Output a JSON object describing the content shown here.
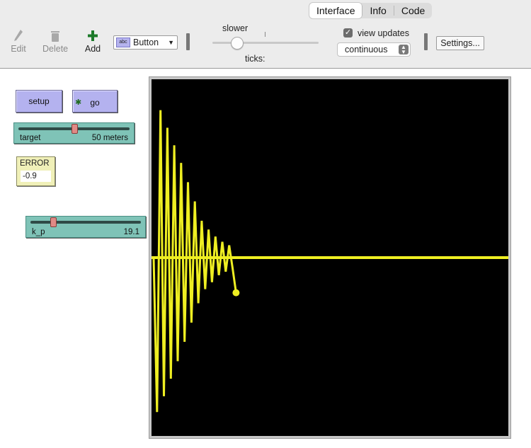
{
  "tabs": [
    {
      "label": "Interface",
      "active": true
    },
    {
      "label": "Info",
      "active": false
    },
    {
      "label": "Code",
      "active": false
    }
  ],
  "toolbar": {
    "edit": {
      "label": "Edit",
      "icon": "pencil-icon"
    },
    "delete": {
      "label": "Delete",
      "icon": "trash-icon"
    },
    "add": {
      "label": "Add",
      "icon": "plus-icon"
    },
    "widget_type": {
      "icon": "abc",
      "value": "Button"
    },
    "speed": {
      "label": "slower",
      "value": 0.25
    },
    "ticks_label": "ticks:",
    "view_updates": {
      "label": "view updates",
      "checked": true
    },
    "update_mode": "continuous",
    "settings_label": "Settings..."
  },
  "widgets": {
    "setup_label": "setup",
    "go_label": "go",
    "target": {
      "name": "target",
      "display": "50 meters",
      "position": 0.5
    },
    "error": {
      "label": "ERROR",
      "value": "-0.9"
    },
    "k_p": {
      "name": "k_p",
      "value": "19.1",
      "position": 0.19
    }
  },
  "view": {
    "background": "#000000",
    "line_color": "#eeee22",
    "amplitudes": [
      0.88,
      0.84,
      0.79,
      0.74,
      0.69,
      0.64,
      0.59,
      0.54,
      0.48,
      0.43,
      0.37,
      0.32,
      0.26,
      0.21,
      0.18,
      0.16,
      0.14,
      0.12,
      0.1,
      0.09,
      0.08,
      0.07,
      0.06
    ],
    "final_offset": -0.2
  },
  "colors": {
    "button": "#b4b2ef",
    "slider": "#7fc3b7",
    "monitor": "#f0f0b8",
    "forever_icon": "#1f6b1f"
  }
}
